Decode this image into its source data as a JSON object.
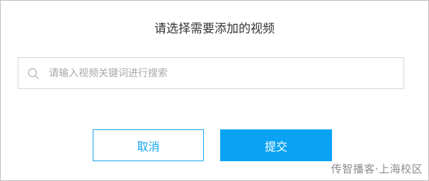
{
  "dialog": {
    "title": "请选择需要添加的视频",
    "search": {
      "icon": "search-icon",
      "placeholder": "请输入视频关键词进行搜索",
      "value": ""
    },
    "buttons": {
      "cancel_label": "取消",
      "submit_label": "提交"
    },
    "colors": {
      "accent": "#0aa3f3",
      "border": "#d6d6d6"
    }
  },
  "watermark": "传智播客·上海校区"
}
